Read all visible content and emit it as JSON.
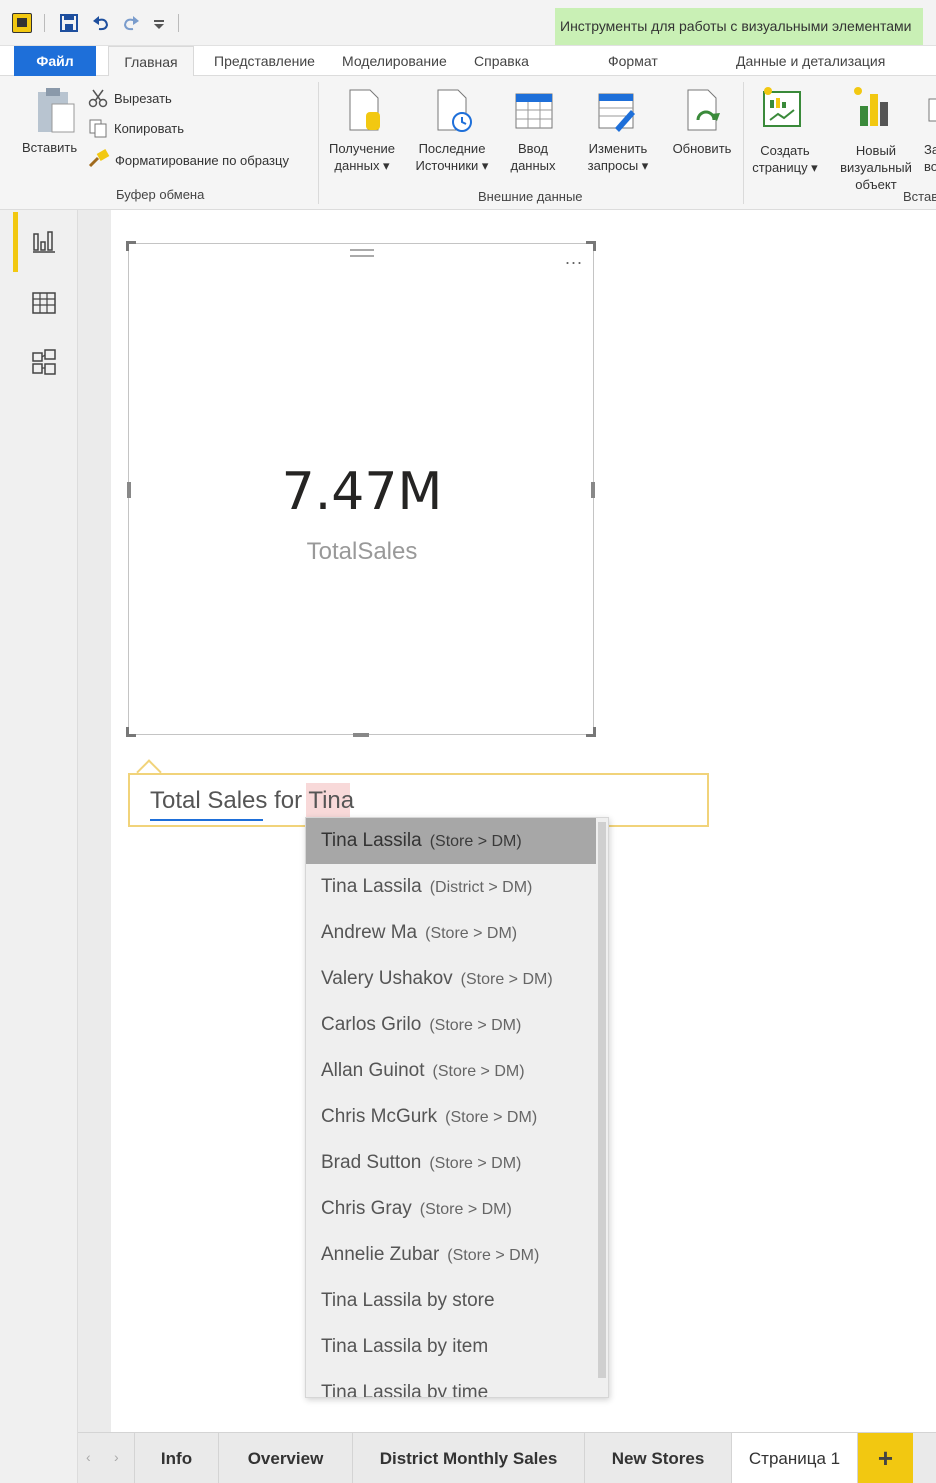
{
  "titlebar": {
    "context_tools_label": "Инструменты для работы с визуальными элементами"
  },
  "tabs": {
    "file": "Файл",
    "home": "Главная",
    "view": "Представление",
    "modeling": "Моделирование",
    "help": "Справка",
    "format": "Формат",
    "data_drill": "Данные и детализация"
  },
  "ribbon": {
    "paste": "Вставить",
    "cut": "Вырезать",
    "copy": "Копировать",
    "format_painter": "Форматирование по образцу",
    "clipboard_group": "Буфер обмена",
    "get_data_1": "Получение",
    "get_data_2": "данных ▾",
    "recent_1": "Последние",
    "recent_2": "Источники ▾",
    "enter_1": "Ввод",
    "enter_2": "данных",
    "edit_1": "Изменить",
    "edit_2": "запросы ▾",
    "refresh": "Обновить",
    "external_group": "Внешние данные",
    "newpage_1": "Создать",
    "newpage_2": "страницу ▾",
    "newvisual_1": "Новый",
    "newvisual_2": "визуальный",
    "newvisual_3": "объект",
    "insert_group_partial": "Встав",
    "cut_off_partial_1": "За",
    "cut_off_partial_2": "во"
  },
  "card": {
    "value": "7.47M",
    "label": "TotalSales",
    "more": "..."
  },
  "qa": {
    "query_prefix": "Total Sales for ",
    "query_term": "Tina"
  },
  "suggestions": [
    {
      "name": "Tina Lassila",
      "path": "(Store > DM)"
    },
    {
      "name": "Tina Lassila",
      "path": "(District > DM)"
    },
    {
      "name": "Andrew Ma",
      "path": "(Store > DM)"
    },
    {
      "name": "Valery Ushakov",
      "path": "(Store > DM)"
    },
    {
      "name": "Carlos Grilo",
      "path": "(Store > DM)"
    },
    {
      "name": "Allan Guinot",
      "path": "(Store > DM)"
    },
    {
      "name": "Chris McGurk",
      "path": "(Store > DM)"
    },
    {
      "name": "Brad Sutton",
      "path": "(Store > DM)"
    },
    {
      "name": "Chris Gray",
      "path": "(Store > DM)"
    },
    {
      "name": "Annelie Zubar",
      "path": "(Store > DM)"
    },
    {
      "name": "Tina Lassila by store",
      "path": ""
    },
    {
      "name": "Tina Lassila by item",
      "path": ""
    },
    {
      "name": "Tina Lassila by time",
      "path": ""
    }
  ],
  "page_tabs": [
    "Info",
    "Overview",
    "District Monthly Sales",
    "New Stores",
    "Страница 1"
  ],
  "add_page": "+"
}
